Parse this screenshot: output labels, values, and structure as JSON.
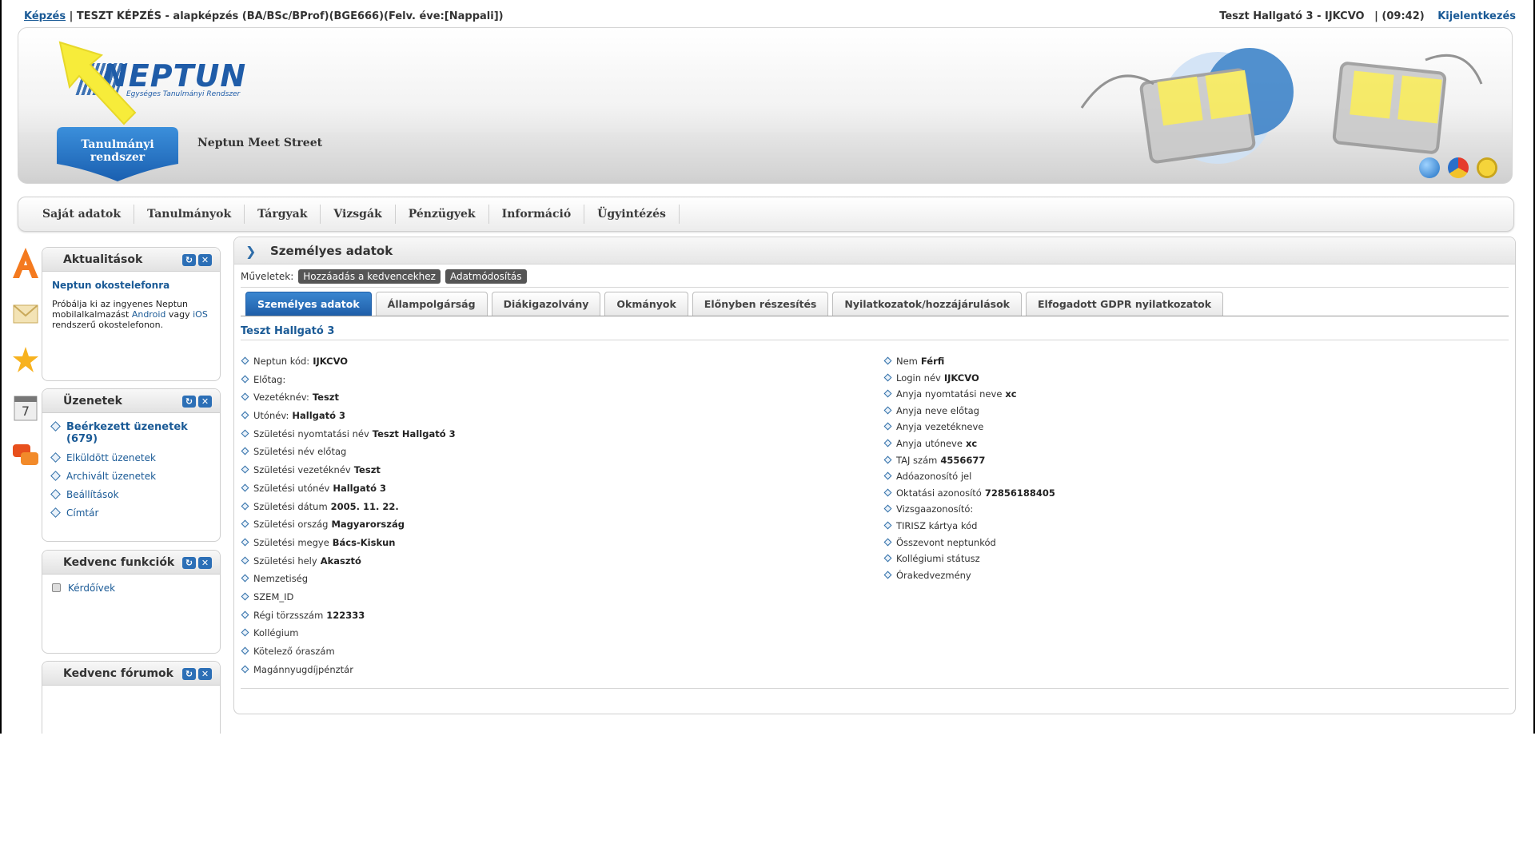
{
  "topbar": {
    "link": "Képzés",
    "sep": " | ",
    "training": "TESZT KÉPZÉS - alapképzés (BA/BSc/BProf)(BGE666)(Felv. éve:[Nappali])",
    "user": "Teszt Hallgató 3 - IJKCVO",
    "time": "|  (09:42)",
    "logout": "Kijelentkezés"
  },
  "header": {
    "logo_word": "NEPTUN",
    "logo_sub": "Egységes Tanulmányi Rendszer",
    "tab_active": "Tanulmányi rendszer",
    "tab_other": "Neptun Meet Street"
  },
  "nav": [
    "Saját adatok",
    "Tanulmányok",
    "Tárgyak",
    "Vizsgák",
    "Pénzügyek",
    "Információ",
    "Ügyintézés"
  ],
  "sidebar": {
    "news": {
      "title": "Aktualitások",
      "item_title": "Neptun okostelefonra",
      "text_1": "Próbálja ki az ingyenes Neptun mobilalkalmazást ",
      "android": "Android",
      "text_2": " vagy ",
      "ios": "iOS",
      "text_3": " rendszerű okostelefonon."
    },
    "messages": {
      "title": "Üzenetek",
      "items": [
        "Beérkezett üzenetek (679)",
        "Elküldött üzenetek",
        "Archivált üzenetek",
        "Beállítások",
        "Címtár"
      ]
    },
    "fav_functions": {
      "title": "Kedvenc funkciók",
      "items": [
        "Kérdőívek"
      ]
    },
    "fav_forums": {
      "title": "Kedvenc fórumok"
    }
  },
  "main": {
    "title": "Személyes adatok",
    "ops_label": "Műveletek:",
    "ops_buttons": [
      "Hozzáadás a kedvencekhez",
      "Adatmódosítás"
    ],
    "tabs": [
      "Személyes adatok",
      "Állampolgárság",
      "Diákigazolvány",
      "Okmányok",
      "Előnyben részesítés",
      "Nyilatkozatok/hozzájárulások",
      "Elfogadott GDPR nyilatkozatok"
    ],
    "person": "Teszt Hallgató 3",
    "left": [
      {
        "label": "Neptun kód:",
        "value": "IJKCVO"
      },
      {
        "label": "Előtag:",
        "value": ""
      },
      {
        "label": "Vezetéknév:",
        "value": "Teszt"
      },
      {
        "label": "Utónév:",
        "value": "Hallgató 3"
      },
      {
        "label": "Születési nyomtatási név",
        "value": "Teszt Hallgató 3"
      },
      {
        "label": "Születési név előtag",
        "value": ""
      },
      {
        "label": "Születési vezetéknév",
        "value": "Teszt"
      },
      {
        "label": "Születési utónév",
        "value": "Hallgató 3"
      },
      {
        "label": "Születési dátum",
        "value": "2005. 11. 22."
      },
      {
        "label": "Születési ország",
        "value": "Magyarország"
      },
      {
        "label": "Születési megye",
        "value": "Bács-Kiskun"
      },
      {
        "label": "Születési hely",
        "value": "Akasztó"
      },
      {
        "label": "Nemzetiség",
        "value": ""
      },
      {
        "label": "SZEM_ID",
        "value": ""
      },
      {
        "label": "Régi törzsszám",
        "value": "122333"
      },
      {
        "label": "Kollégium",
        "value": ""
      },
      {
        "label": "Kötelező óraszám",
        "value": ""
      },
      {
        "label": "Magánnyugdíjpénztár",
        "value": ""
      }
    ],
    "right": [
      {
        "label": "Nem",
        "value": "Férfi"
      },
      {
        "label": "Login név",
        "value": "IJKCVO"
      },
      {
        "label": "Anyja nyomtatási neve",
        "value": "xc"
      },
      {
        "label": "Anyja neve előtag",
        "value": ""
      },
      {
        "label": "Anyja vezetékneve",
        "value": ""
      },
      {
        "label": "Anyja utóneve",
        "value": "xc"
      },
      {
        "label": "TAJ szám",
        "value": "4556677"
      },
      {
        "label": "Adóazonosító jel",
        "value": ""
      },
      {
        "label": "Oktatási azonosító",
        "value": "72856188405"
      },
      {
        "label": "Vizsgaazonosító:",
        "value": ""
      },
      {
        "label": "TIRISZ kártya kód",
        "value": ""
      },
      {
        "label": "Összevont neptunkód",
        "value": ""
      },
      {
        "label": "Kollégiumi státusz",
        "value": ""
      },
      {
        "label": "Órakedvezmény",
        "value": ""
      }
    ]
  }
}
